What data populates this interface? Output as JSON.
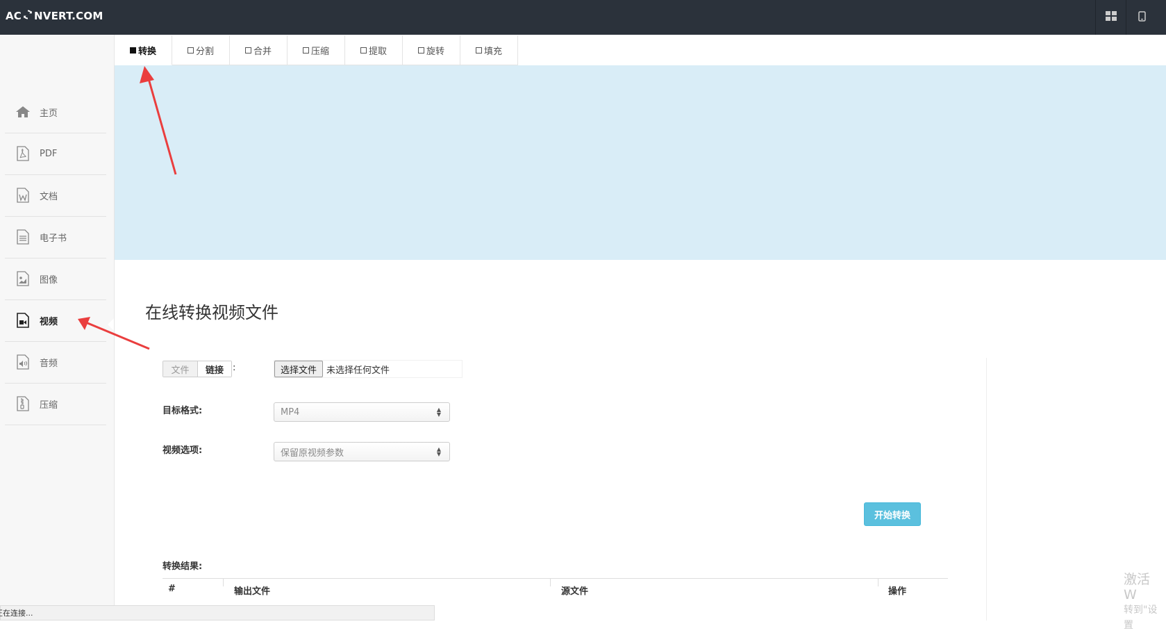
{
  "header": {
    "logo_pre": "AC",
    "logo_post": "NVERT.COM",
    "buttons": [
      "grid-view",
      "mobile-view"
    ]
  },
  "tabs": [
    {
      "label": "转换",
      "active": true
    },
    {
      "label": "分割",
      "active": false
    },
    {
      "label": "合并",
      "active": false
    },
    {
      "label": "压缩",
      "active": false
    },
    {
      "label": "提取",
      "active": false
    },
    {
      "label": "旋转",
      "active": false
    },
    {
      "label": "填充",
      "active": false
    }
  ],
  "sidebar": {
    "items": [
      {
        "label": "主页",
        "icon": "home-icon"
      },
      {
        "label": "PDF",
        "icon": "pdf-file-icon"
      },
      {
        "label": "文档",
        "icon": "word-file-icon"
      },
      {
        "label": "电子书",
        "icon": "ebook-file-icon"
      },
      {
        "label": "图像",
        "icon": "image-file-icon"
      },
      {
        "label": "视频",
        "icon": "video-file-icon",
        "active": true
      },
      {
        "label": "音频",
        "icon": "audio-file-icon"
      },
      {
        "label": "压缩",
        "icon": "archive-file-icon"
      }
    ]
  },
  "main": {
    "title": "在线转换视频文件",
    "source": {
      "file_label": "文件",
      "link_label": "链接",
      "colon": ":"
    },
    "file_input": {
      "button": "选择文件",
      "status": "未选择任何文件"
    },
    "target_format": {
      "label": "目标格式:",
      "value": "MP4"
    },
    "video_options": {
      "label": "视频选项:",
      "value": "保留原视频参数"
    },
    "start_button": "开始转换",
    "results": {
      "label": "转换结果:",
      "columns": [
        "#",
        "输出文件",
        "源文件",
        "操作"
      ]
    }
  },
  "status_bar": "正在连接...",
  "watermark": {
    "line1": "激活 W",
    "line2": "转到\"设置"
  },
  "colors": {
    "topbar": "#2b323b",
    "banner": "#d9edf7",
    "start_button": "#5bc0de",
    "annotation_arrow": "#ea3e3e"
  }
}
